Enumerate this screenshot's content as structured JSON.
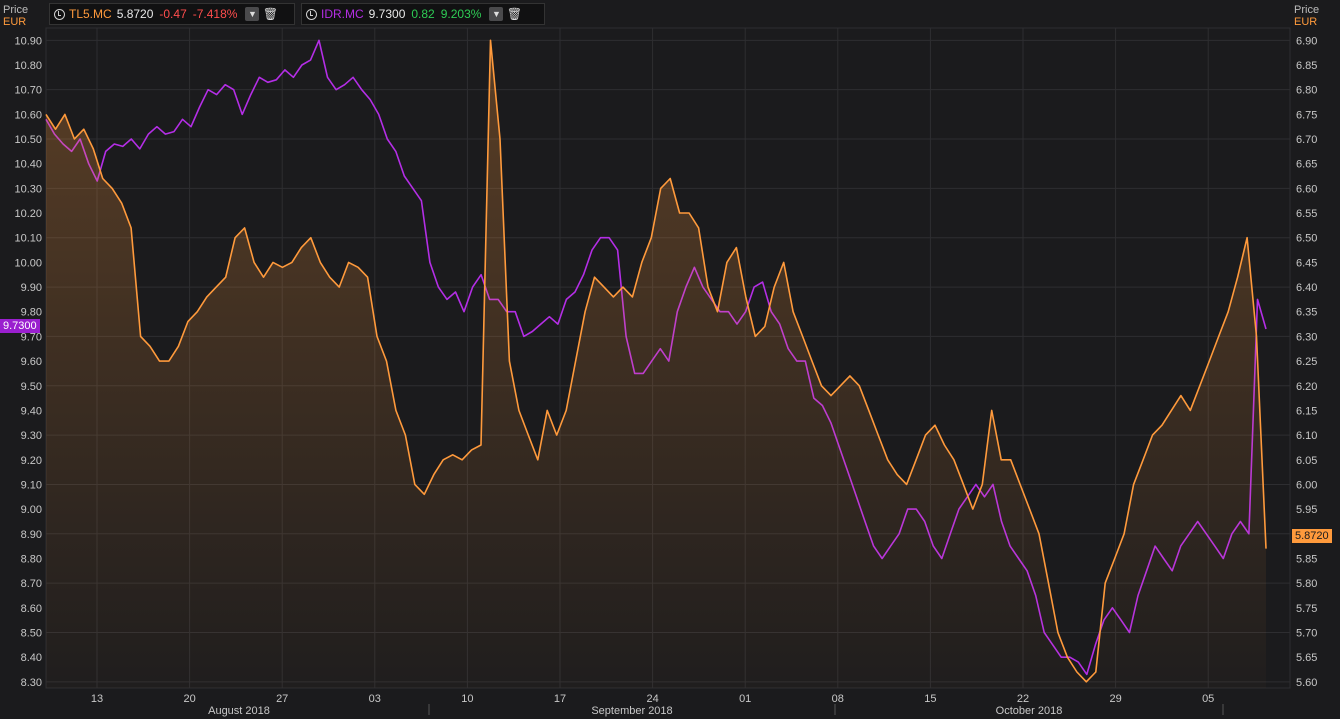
{
  "legend": [
    {
      "icon": "clock-icon",
      "ric": "TL5.MC",
      "price": "5.8720",
      "change": "-0.47",
      "pct": "-7.418%",
      "color": "#ff9a3c",
      "change_color": "#ff4d4d"
    },
    {
      "icon": "clock-icon",
      "ric": "IDR.MC",
      "price": "9.7300",
      "change": "0.82",
      "pct": "9.203%",
      "color": "#b42ee6",
      "change_color": "#2ecc55"
    }
  ],
  "left_axis_unit": {
    "title": "Price",
    "currency": "EUR"
  },
  "right_axis_unit": {
    "title": "Price",
    "currency": "EUR"
  },
  "left_badge": "9.7300",
  "right_badge": "5.8720",
  "colors": {
    "background": "#1b1b1d",
    "grid": "#2e2e31",
    "orange": "#ff9a3c",
    "purple": "#b42ee6",
    "axis_text": "#c8c8c8"
  },
  "chart_data": {
    "type": "line",
    "x_ticks": [
      "13",
      "20",
      "27",
      "03",
      "10",
      "17",
      "24",
      "01",
      "08",
      "15",
      "22",
      "29",
      "05"
    ],
    "month_labels": [
      "August 2018",
      "September 2018",
      "October 2018"
    ],
    "y_left_ticks": [
      "10.90",
      "10.80",
      "10.70",
      "10.60",
      "10.50",
      "10.40",
      "10.30",
      "10.20",
      "10.10",
      "10.00",
      "9.90",
      "9.80",
      "9.70",
      "9.60",
      "9.50",
      "9.40",
      "9.30",
      "9.20",
      "9.10",
      "9.00",
      "8.90",
      "8.80",
      "8.70",
      "8.60",
      "8.50",
      "8.40",
      "8.30"
    ],
    "y_right_ticks": [
      "6.90",
      "6.85",
      "6.80",
      "6.75",
      "6.70",
      "6.65",
      "6.60",
      "6.55",
      "6.50",
      "6.45",
      "6.40",
      "6.35",
      "6.30",
      "6.25",
      "6.20",
      "6.15",
      "6.10",
      "6.05",
      "6.00",
      "5.95",
      "5.90",
      "5.85",
      "5.80",
      "5.75",
      "5.70",
      "5.65",
      "5.60"
    ],
    "y_left_range": [
      8.275,
      10.95
    ],
    "y_right_range": [
      5.5875,
      6.925
    ],
    "series": [
      {
        "name": "IDR.MC",
        "axis": "left",
        "values": [
          10.58,
          10.52,
          10.48,
          10.45,
          10.5,
          10.4,
          10.33,
          10.45,
          10.48,
          10.47,
          10.5,
          10.46,
          10.52,
          10.55,
          10.52,
          10.53,
          10.58,
          10.55,
          10.63,
          10.7,
          10.68,
          10.72,
          10.7,
          10.6,
          10.68,
          10.75,
          10.73,
          10.74,
          10.78,
          10.75,
          10.8,
          10.82,
          10.9,
          10.75,
          10.7,
          10.72,
          10.75,
          10.7,
          10.66,
          10.6,
          10.5,
          10.45,
          10.35,
          10.3,
          10.25,
          10.0,
          9.9,
          9.85,
          9.88,
          9.8,
          9.9,
          9.95,
          9.85,
          9.85,
          9.8,
          9.8,
          9.7,
          9.72,
          9.75,
          9.78,
          9.75,
          9.85,
          9.88,
          9.95,
          10.05,
          10.1,
          10.1,
          10.05,
          9.7,
          9.55,
          9.55,
          9.6,
          9.65,
          9.6,
          9.8,
          9.9,
          9.98,
          9.9,
          9.85,
          9.8,
          9.8,
          9.75,
          9.8,
          9.9,
          9.92,
          9.8,
          9.75,
          9.65,
          9.6,
          9.6,
          9.45,
          9.42,
          9.35,
          9.25,
          9.15,
          9.05,
          8.95,
          8.85,
          8.8,
          8.85,
          8.9,
          9.0,
          9.0,
          8.95,
          8.85,
          8.8,
          8.9,
          9.0,
          9.05,
          9.1,
          9.05,
          9.1,
          8.95,
          8.85,
          8.8,
          8.75,
          8.65,
          8.5,
          8.45,
          8.4,
          8.4,
          8.38,
          8.33,
          8.45,
          8.55,
          8.6,
          8.55,
          8.5,
          8.65,
          8.75,
          8.85,
          8.8,
          8.75,
          8.85,
          8.9,
          8.95,
          8.9,
          8.85,
          8.8,
          8.9,
          8.95,
          8.9,
          9.85,
          9.73
        ]
      },
      {
        "name": "TL5.MC",
        "axis": "right",
        "values": [
          6.75,
          6.72,
          6.75,
          6.7,
          6.72,
          6.68,
          6.62,
          6.6,
          6.57,
          6.52,
          6.3,
          6.28,
          6.25,
          6.25,
          6.28,
          6.33,
          6.35,
          6.38,
          6.4,
          6.42,
          6.5,
          6.52,
          6.45,
          6.42,
          6.45,
          6.44,
          6.45,
          6.48,
          6.5,
          6.45,
          6.42,
          6.4,
          6.45,
          6.44,
          6.42,
          6.3,
          6.25,
          6.15,
          6.1,
          6.0,
          5.98,
          6.02,
          6.05,
          6.06,
          6.05,
          6.07,
          6.08,
          6.9,
          6.7,
          6.25,
          6.15,
          6.1,
          6.05,
          6.15,
          6.1,
          6.15,
          6.25,
          6.35,
          6.42,
          6.4,
          6.38,
          6.4,
          6.38,
          6.45,
          6.5,
          6.6,
          6.62,
          6.55,
          6.55,
          6.52,
          6.4,
          6.35,
          6.45,
          6.48,
          6.38,
          6.3,
          6.32,
          6.4,
          6.45,
          6.35,
          6.3,
          6.25,
          6.2,
          6.18,
          6.2,
          6.22,
          6.2,
          6.15,
          6.1,
          6.05,
          6.02,
          6.0,
          6.05,
          6.1,
          6.12,
          6.08,
          6.05,
          6.0,
          5.95,
          6.0,
          6.15,
          6.05,
          6.05,
          6.0,
          5.95,
          5.9,
          5.8,
          5.7,
          5.65,
          5.62,
          5.6,
          5.62,
          5.8,
          5.85,
          5.9,
          6.0,
          6.05,
          6.1,
          6.12,
          6.15,
          6.18,
          6.15,
          6.2,
          6.25,
          6.3,
          6.35,
          6.42,
          6.5,
          6.3,
          5.87
        ]
      }
    ],
    "grid": true
  }
}
